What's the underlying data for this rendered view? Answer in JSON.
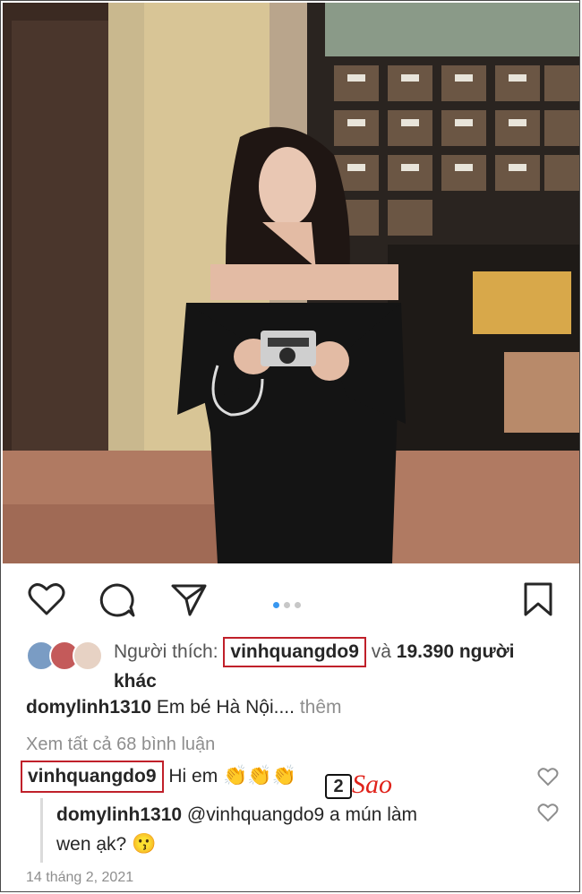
{
  "post": {
    "likes": {
      "prefix": "Người thích:",
      "liker": "vinhquangdo9",
      "connector": "và",
      "count_text": "19.390 người",
      "suffix": "khác"
    },
    "caption": {
      "username": "domylinh1310",
      "text": "Em bé Hà Nội....",
      "more": "thêm"
    },
    "view_all_comments": "Xem tất cả 68 bình luận",
    "comments": [
      {
        "username": "vinhquangdo9",
        "text": "Hi em",
        "emoji": "👏👏👏"
      },
      {
        "username": "domylinh1310",
        "text": "@vinhquangdo9 a mún làm",
        "text2": "wen ạk?",
        "emoji": "😗"
      }
    ],
    "date": "14 tháng 2, 2021",
    "carousel": {
      "total": 3,
      "active": 1
    }
  },
  "watermark": {
    "number": "2",
    "brand": "Sao"
  },
  "icons": [
    "heart-icon",
    "comment-icon",
    "share-icon",
    "bookmark-icon",
    "small-heart-icon"
  ],
  "colors": {
    "highlight_box": "#c0202a",
    "carousel_active": "#3897f0",
    "watermark_red": "#e0231b"
  }
}
